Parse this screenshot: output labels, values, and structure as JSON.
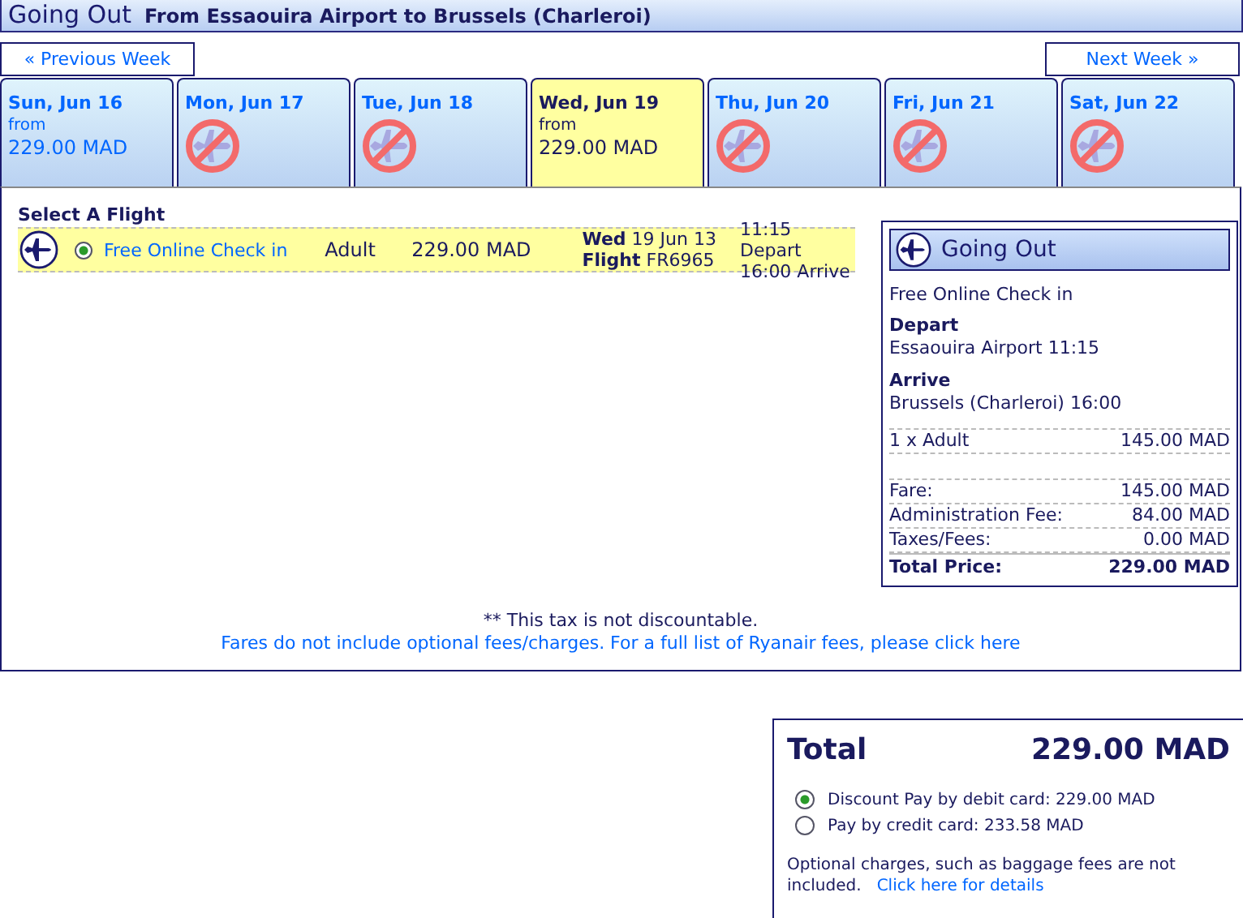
{
  "header": {
    "title": "Going Out",
    "route": "From Essaouira Airport to Brussels (Charleroi)"
  },
  "week_nav": {
    "previous": "« Previous Week",
    "next": "Next Week »"
  },
  "days": [
    {
      "label": "Sun, Jun 16",
      "kind": "fares",
      "from": "from",
      "price": "229.00 MAD",
      "selected": false
    },
    {
      "label": "Mon, Jun 17",
      "kind": "no_flights",
      "selected": false
    },
    {
      "label": "Tue, Jun 18",
      "kind": "no_flights",
      "selected": false
    },
    {
      "label": "Wed, Jun 19",
      "kind": "fares",
      "from": "from",
      "price": "229.00 MAD",
      "selected": true
    },
    {
      "label": "Thu, Jun 20",
      "kind": "no_flights",
      "selected": false
    },
    {
      "label": "Fri, Jun 21",
      "kind": "no_flights",
      "selected": false
    },
    {
      "label": "Sat, Jun 22",
      "kind": "no_flights",
      "selected": false
    }
  ],
  "flights": {
    "heading": "Select A Flight",
    "rows": [
      {
        "selected": true,
        "fare_type": "Free Online Check in",
        "passenger": "Adult",
        "price": "229.00 MAD",
        "day": "Wed",
        "date": "19 Jun 13",
        "flight_label": "Flight",
        "flight_number": "FR6965",
        "depart": "11:15 Depart",
        "arrive": "16:00 Arrive"
      }
    ]
  },
  "summary": {
    "title": "Going Out",
    "fare_type": "Free Online Check in",
    "depart_label": "Depart",
    "depart": "Essaouira Airport 11:15",
    "arrive_label": "Arrive",
    "arrive": "Brussels (Charleroi) 16:00",
    "passengers": [
      {
        "label": "1 x Adult",
        "value": "145.00 MAD"
      }
    ],
    "fees": [
      {
        "label": "Fare:",
        "value": "145.00 MAD"
      },
      {
        "label": "Administration Fee:",
        "value": "84.00 MAD"
      },
      {
        "label": "Taxes/Fees:",
        "value": "0.00 MAD"
      }
    ],
    "total": {
      "label": "Total Price:",
      "value": "229.00 MAD"
    }
  },
  "notes": {
    "tax_note": "** This tax is not discountable.",
    "fees_link": "Fares do not include optional fees/charges. For a full list of Ryanair fees, please click here"
  },
  "total_box": {
    "label": "Total",
    "amount": "229.00 MAD",
    "payment_options": [
      {
        "label": "Discount Pay by debit card: 229.00 MAD",
        "selected": true
      },
      {
        "label": "Pay by credit card: 233.58 MAD",
        "selected": false
      }
    ],
    "note": "Optional charges, such as baggage fees are not included.",
    "details_link": "Click here for details"
  }
}
